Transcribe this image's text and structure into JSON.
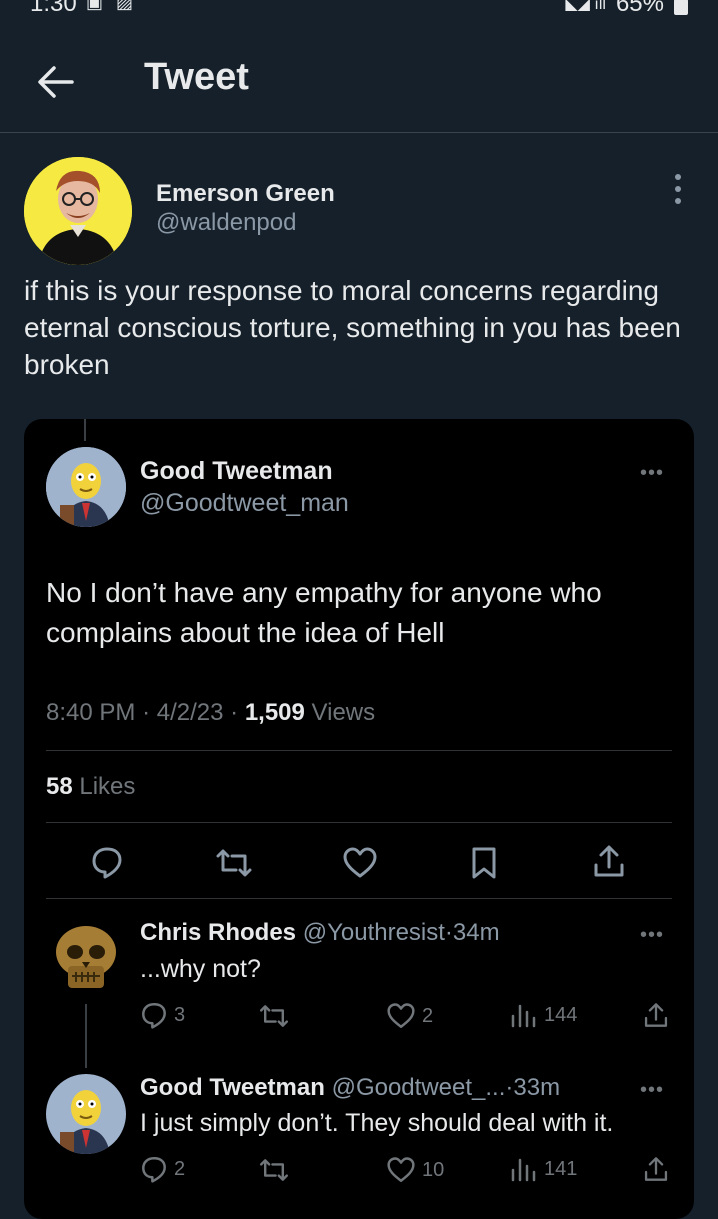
{
  "status": {
    "time": "1:30",
    "battery": "65%"
  },
  "header": {
    "title": "Tweet"
  },
  "tweet": {
    "author_name": "Emerson Green",
    "author_handle": "@waldenpod",
    "text": "if this is your response to moral concerns regarding eternal conscious torture, something in you has been broken"
  },
  "quote": {
    "author_name": "Good Tweetman",
    "author_handle": "@Goodtweet_man",
    "text": "No I don’t have any empathy for anyone who complains about the idea of Hell",
    "time": "8:40 PM",
    "date": "4/2/23",
    "views_count": "1,509",
    "views_label": "Views",
    "likes_count": "58",
    "likes_label": "Likes"
  },
  "replies": [
    {
      "name": "Chris Rhodes",
      "handle": "@Youthresist",
      "age": "34m",
      "text": "...why not?",
      "replies": "3",
      "retweets": "",
      "likes": "2",
      "views": "144"
    },
    {
      "name": "Good Tweetman",
      "handle": "@Goodtweet_...",
      "age": "33m",
      "text": "I just simply don’t. They should deal with it.",
      "replies": "2",
      "retweets": "",
      "likes": "10",
      "views": "141"
    }
  ],
  "colors": {
    "background": "#15202b",
    "card": "#000000",
    "secondary_text": "#8b98a5",
    "primary_text": "#e7e9ea"
  }
}
